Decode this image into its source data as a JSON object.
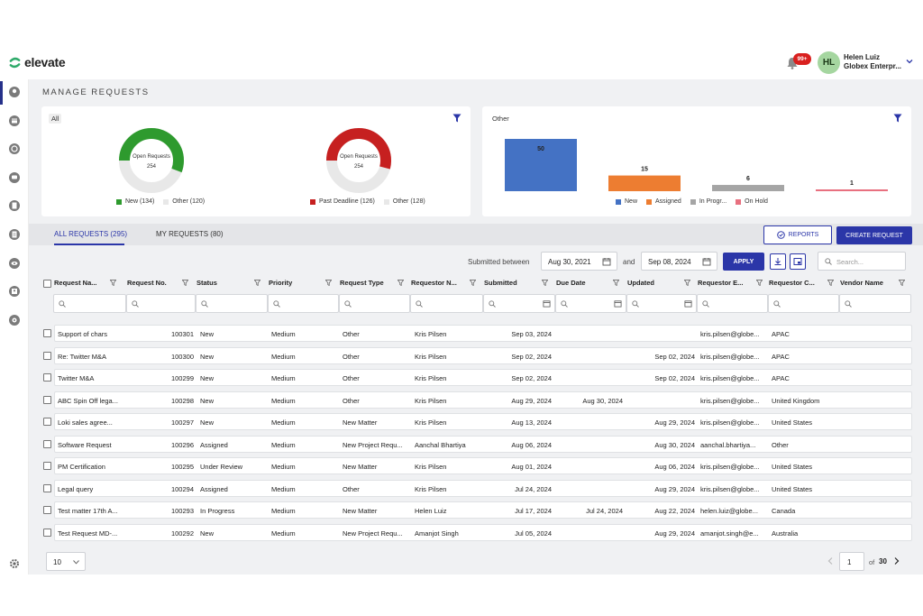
{
  "brand": {
    "name": "elevate",
    "color": "#2eaa6a"
  },
  "header": {
    "notifications_badge": "99+",
    "user": {
      "initials": "HL",
      "name": "Helen Luiz",
      "org": "Globex Enterpr..."
    }
  },
  "sidebar": {
    "icons": [
      "location-pin-icon",
      "calendar-icon",
      "support-icon",
      "message-icon",
      "document-icon",
      "file-icon",
      "eye-icon",
      "person-card-icon",
      "settings-cog-icon"
    ],
    "settings_icon": "gear-icon"
  },
  "page": {
    "title": "MANAGE REQUESTS"
  },
  "charts": {
    "left_card": {
      "label": "All",
      "donut1": {
        "center_title": "Open Requests",
        "center_value": "254",
        "legend": [
          "New (134)",
          "Other (120)"
        ],
        "colors": [
          "#2e9a2e",
          "#e8e8e8"
        ]
      },
      "donut2": {
        "center_title": "Open Requests",
        "center_value": "254",
        "legend": [
          "Past Deadline (126)",
          "Other (128)"
        ],
        "colors": [
          "#c62020",
          "#e8e8e8"
        ]
      }
    },
    "right_card": {
      "label": "Other"
    }
  },
  "chart_data": [
    {
      "type": "pie",
      "title": "Open Requests",
      "center_value": "254",
      "categories": [
        "New",
        "Other"
      ],
      "values": [
        134,
        120
      ],
      "legend": "bottom"
    },
    {
      "type": "pie",
      "title": "Open Requests",
      "center_value": "254",
      "categories": [
        "Past Deadline",
        "Other"
      ],
      "values": [
        126,
        128
      ],
      "legend": "bottom"
    },
    {
      "type": "bar",
      "categories": [
        "New",
        "Assigned",
        "In Progr...",
        "On Hold"
      ],
      "values": [
        50,
        15,
        6,
        1
      ],
      "colors": [
        "#4472c4",
        "#ed7d31",
        "#a5a5a5",
        "#e8707f"
      ],
      "legend": "bottom"
    }
  ],
  "tabs": [
    {
      "label": "ALL REQUESTS (295)",
      "active": true
    },
    {
      "label": "MY REQUESTS (80)",
      "active": false
    }
  ],
  "actions": {
    "reports": "REPORTS",
    "create": "CREATE REQUEST",
    "apply": "APPLY"
  },
  "filters": {
    "submitted_between_label": "Submitted between",
    "from": "Aug 30, 2021",
    "and_label": "and",
    "to": "Sep 08, 2024",
    "search_placeholder": "Search..."
  },
  "table": {
    "columns": [
      "Request Na...",
      "Request No.",
      "Status",
      "Priority",
      "Request Type",
      "Requestor N...",
      "Submitted",
      "Due Date",
      "Updated",
      "Requestor E...",
      "Requestor C...",
      "Vendor Name"
    ],
    "rows": [
      [
        "Support of chars",
        "100301",
        "New",
        "Medium",
        "Other",
        "Kris Pilsen",
        "Sep 03, 2024",
        "",
        "",
        "kris.pilsen@globe...",
        "APAC",
        ""
      ],
      [
        "Re: Twitter M&A",
        "100300",
        "New",
        "Medium",
        "Other",
        "Kris Pilsen",
        "Sep 02, 2024",
        "",
        "Sep 02, 2024",
        "kris.pilsen@globe...",
        "APAC",
        ""
      ],
      [
        "Twitter M&A",
        "100299",
        "New",
        "Medium",
        "Other",
        "Kris Pilsen",
        "Sep 02, 2024",
        "",
        "Sep 02, 2024",
        "kris.pilsen@globe...",
        "APAC",
        ""
      ],
      [
        "ABC Spin Off lega...",
        "100298",
        "New",
        "Medium",
        "Other",
        "Kris Pilsen",
        "Aug 29, 2024",
        "Aug 30, 2024",
        "",
        "kris.pilsen@globe...",
        "United Kingdom",
        ""
      ],
      [
        "Loki sales agree...",
        "100297",
        "New",
        "Medium",
        "New Matter",
        "Kris Pilsen",
        "Aug 13, 2024",
        "",
        "Aug 29, 2024",
        "kris.pilsen@globe...",
        "United States",
        ""
      ],
      [
        "Software Request",
        "100296",
        "Assigned",
        "Medium",
        "New Project Requ...",
        "Aanchal Bhartiya",
        "Aug 06, 2024",
        "",
        "Aug 30, 2024",
        "aanchal.bhartiya...",
        "Other",
        ""
      ],
      [
        "PM Certification",
        "100295",
        "Under Review",
        "Medium",
        "New Matter",
        "Kris Pilsen",
        "Aug 01, 2024",
        "",
        "Aug 06, 2024",
        "kris.pilsen@globe...",
        "United States",
        ""
      ],
      [
        "Legal query",
        "100294",
        "Assigned",
        "Medium",
        "Other",
        "Kris Pilsen",
        "Jul 24, 2024",
        "",
        "Aug 29, 2024",
        "kris.pilsen@globe...",
        "United States",
        ""
      ],
      [
        "Test matter 17th A...",
        "100293",
        "In Progress",
        "Medium",
        "New Matter",
        "Helen Luiz",
        "Jul 17, 2024",
        "Jul 24, 2024",
        "Aug 22, 2024",
        "helen.luiz@globe...",
        "Canada",
        ""
      ],
      [
        "Test Request MD-...",
        "100292",
        "New",
        "Medium",
        "New Project Requ...",
        "Amanjot Singh",
        "Jul 05, 2024",
        "",
        "Aug 29, 2024",
        "amanjot.singh@e...",
        "Australia",
        ""
      ]
    ]
  },
  "pagination": {
    "page_size": "10",
    "current_page": "1",
    "of_label": "of",
    "total_pages": "30"
  },
  "colors": {
    "primary": "#2b36a8",
    "content_bg": "#f0f1f3"
  }
}
